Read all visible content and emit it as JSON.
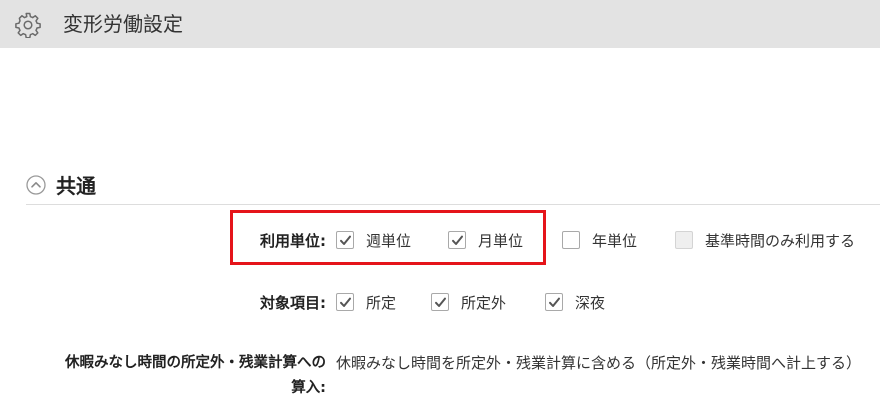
{
  "header": {
    "title": "変形労働設定",
    "icon": "gear-icon"
  },
  "section": {
    "title": "共通",
    "icon": "chevron-up-circle-icon"
  },
  "units": {
    "label": "利用単位:",
    "options": [
      {
        "label": "週単位",
        "checked": true
      },
      {
        "label": "月単位",
        "checked": true
      },
      {
        "label": "年単位",
        "checked": false
      },
      {
        "label": "基準時間のみ利用する",
        "checked": false,
        "disabled": true
      }
    ]
  },
  "items": {
    "label": "対象項目:",
    "options": [
      {
        "label": "所定",
        "checked": true
      },
      {
        "label": "所定外",
        "checked": true
      },
      {
        "label": "深夜",
        "checked": true
      }
    ]
  },
  "vacation": {
    "label_line1": "休暇みなし時間の所定外・残業計算への",
    "label_line2": "算入:",
    "value": "休暇みなし時間を所定外・残業計算に含める（所定外・残業時間へ計上する）"
  },
  "colors": {
    "highlight": "#e5141a",
    "header_bg": "#e3e3e3",
    "check": "#555555"
  }
}
